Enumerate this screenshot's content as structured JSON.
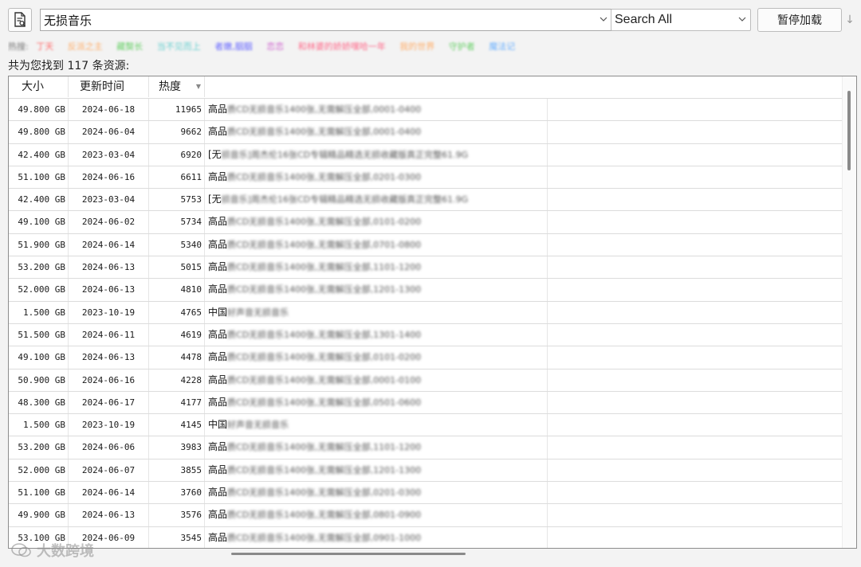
{
  "toolbar": {
    "search_value": "无损音乐",
    "scope_value": "Search All",
    "pause_label": "暂停加载",
    "down_label": "↓"
  },
  "tags": {
    "label": "热搜:",
    "items": [
      {
        "text": "丁天",
        "color": "#ff6a6a"
      },
      {
        "text": "反派之主",
        "color": "#ffae6a"
      },
      {
        "text": "藏獒长",
        "color": "#6ad06a"
      },
      {
        "text": "当不见而上",
        "color": "#6ad0d0"
      },
      {
        "text": "者嫩,胭胭",
        "color": "#6a6aff"
      },
      {
        "text": "恋恋",
        "color": "#d06ad0"
      },
      {
        "text": "和林婆的娇娇嘿哈一年",
        "color": "#ff6a8a"
      },
      {
        "text": "我的世界",
        "color": "#ffae6a"
      },
      {
        "text": "守护者",
        "color": "#6ad06a"
      },
      {
        "text": "魔法记",
        "color": "#6ab0ff"
      }
    ]
  },
  "count_text": "共为您找到 117 条资源:",
  "table": {
    "headers": {
      "size": "大小",
      "date": "更新时间",
      "heat": "热度"
    },
    "rows": [
      {
        "size": "49.800 GB",
        "date": "2024-06-18",
        "heat": "11965",
        "title_clear": "高品",
        "title_blur": "质CD无损音乐1400张,无需解压全部,0001-0400"
      },
      {
        "size": "49.800 GB",
        "date": "2024-06-04",
        "heat": "9662",
        "title_clear": "高品",
        "title_blur": "质CD无损音乐1400张,无需解压全部,0001-0400"
      },
      {
        "size": "42.400 GB",
        "date": "2023-03-04",
        "heat": "6920",
        "title_clear": "[无",
        "title_blur": "损音乐]周杰伦16张CD专辑精品精选无损收藏版真正完整61.9G"
      },
      {
        "size": "51.100 GB",
        "date": "2024-06-16",
        "heat": "6611",
        "title_clear": "高品",
        "title_blur": "质CD无损音乐1400张,无需解压全部,0201-0300"
      },
      {
        "size": "42.400 GB",
        "date": "2023-03-04",
        "heat": "5753",
        "title_clear": "[无",
        "title_blur": "损音乐]周杰伦16张CD专辑精品精选无损收藏版真正完整61.9G"
      },
      {
        "size": "49.100 GB",
        "date": "2024-06-02",
        "heat": "5734",
        "title_clear": "高品",
        "title_blur": "质CD无损音乐1400张,无需解压全部,0101-0200"
      },
      {
        "size": "51.900 GB",
        "date": "2024-06-14",
        "heat": "5340",
        "title_clear": "高品",
        "title_blur": "质CD无损音乐1400张,无需解压全部,0701-0800"
      },
      {
        "size": "53.200 GB",
        "date": "2024-06-13",
        "heat": "5015",
        "title_clear": "高品",
        "title_blur": "质CD无损音乐1400张,无需解压全部,1101-1200"
      },
      {
        "size": "52.000 GB",
        "date": "2024-06-13",
        "heat": "4810",
        "title_clear": "高品",
        "title_blur": "质CD无损音乐1400张,无需解压全部,1201-1300"
      },
      {
        "size": "1.500 GB",
        "date": "2023-10-19",
        "heat": "4765",
        "title_clear": "中国",
        "title_blur": "好声音无损音乐"
      },
      {
        "size": "51.500 GB",
        "date": "2024-06-11",
        "heat": "4619",
        "title_clear": "高品",
        "title_blur": "质CD无损音乐1400张,无需解压全部,1301-1400"
      },
      {
        "size": "49.100 GB",
        "date": "2024-06-13",
        "heat": "4478",
        "title_clear": "高品",
        "title_blur": "质CD无损音乐1400张,无需解压全部,0101-0200"
      },
      {
        "size": "50.900 GB",
        "date": "2024-06-16",
        "heat": "4228",
        "title_clear": "高品",
        "title_blur": "质CD无损音乐1400张,无需解压全部,0001-0100"
      },
      {
        "size": "48.300 GB",
        "date": "2024-06-17",
        "heat": "4177",
        "title_clear": "高品",
        "title_blur": "质CD无损音乐1400张,无需解压全部,0501-0600"
      },
      {
        "size": "1.500 GB",
        "date": "2023-10-19",
        "heat": "4145",
        "title_clear": "中国",
        "title_blur": "好声音无损音乐"
      },
      {
        "size": "53.200 GB",
        "date": "2024-06-06",
        "heat": "3983",
        "title_clear": "高品",
        "title_blur": "质CD无损音乐1400张,无需解压全部,1101-1200"
      },
      {
        "size": "52.000 GB",
        "date": "2024-06-07",
        "heat": "3855",
        "title_clear": "高品",
        "title_blur": "质CD无损音乐1400张,无需解压全部,1201-1300"
      },
      {
        "size": "51.100 GB",
        "date": "2024-06-14",
        "heat": "3760",
        "title_clear": "高品",
        "title_blur": "质CD无损音乐1400张,无需解压全部,0201-0300"
      },
      {
        "size": "49.900 GB",
        "date": "2024-06-13",
        "heat": "3576",
        "title_clear": "高品",
        "title_blur": "质CD无损音乐1400张,无需解压全部,0801-0900"
      },
      {
        "size": "53.100 GB",
        "date": "2024-06-09",
        "heat": "3545",
        "title_clear": "高品",
        "title_blur": "质CD无损音乐1400张,无需解压全部,0901-1000"
      }
    ]
  },
  "watermark": "大数跨境",
  "icons": {
    "doc": "document-search-icon",
    "dropdown": "chevron-down-icon",
    "sort": "sort-desc-icon"
  }
}
